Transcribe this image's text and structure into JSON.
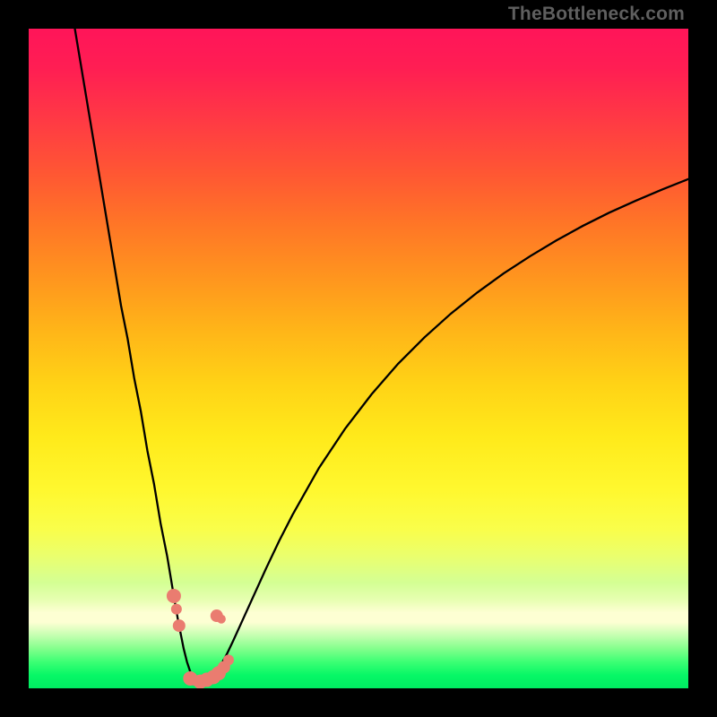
{
  "watermark": "TheBottleneck.com",
  "chart_data": {
    "type": "line",
    "title": "",
    "xlabel": "",
    "ylabel": "",
    "xlim": [
      0,
      100
    ],
    "ylim": [
      0,
      100
    ],
    "grid": false,
    "legend": false,
    "series": [
      {
        "name": "bottleneck-curve",
        "color": "#000000",
        "x": [
          7,
          8,
          9,
          10,
          11,
          12,
          13,
          14,
          15,
          16,
          17,
          18,
          19,
          20,
          21,
          22,
          22.7,
          23.5,
          24,
          24.5,
          25,
          25.5,
          26,
          27,
          28,
          29,
          30,
          31,
          32,
          34,
          36,
          38,
          40,
          44,
          48,
          52,
          56,
          60,
          64,
          68,
          72,
          76,
          80,
          84,
          88,
          92,
          96,
          100
        ],
        "y": [
          100,
          94,
          88,
          82,
          76,
          70,
          64,
          58,
          53,
          47,
          42,
          36,
          31,
          25,
          20,
          14,
          10,
          6,
          4,
          2.5,
          1.3,
          0.7,
          0.3,
          0.7,
          1.8,
          3.3,
          5.1,
          7.2,
          9.4,
          13.8,
          18.2,
          22.4,
          26.3,
          33.4,
          39.4,
          44.6,
          49.2,
          53.2,
          56.8,
          60.0,
          62.9,
          65.5,
          67.9,
          70.1,
          72.1,
          73.9,
          75.6,
          77.2
        ]
      }
    ],
    "markers": [
      {
        "x": 22.0,
        "y": 14.0,
        "r": 8
      },
      {
        "x": 22.4,
        "y": 12.0,
        "r": 6
      },
      {
        "x": 22.8,
        "y": 9.5,
        "r": 7
      },
      {
        "x": 28.5,
        "y": 11.0,
        "r": 7
      },
      {
        "x": 29.2,
        "y": 10.5,
        "r": 5
      },
      {
        "x": 24.5,
        "y": 1.5,
        "r": 8
      },
      {
        "x": 25.2,
        "y": 1.2,
        "r": 6
      },
      {
        "x": 26.0,
        "y": 1.0,
        "r": 8
      },
      {
        "x": 27.0,
        "y": 1.3,
        "r": 8
      },
      {
        "x": 28.0,
        "y": 1.7,
        "r": 8
      },
      {
        "x": 28.8,
        "y": 2.3,
        "r": 8
      },
      {
        "x": 29.6,
        "y": 3.2,
        "r": 7
      },
      {
        "x": 30.3,
        "y": 4.3,
        "r": 6
      }
    ],
    "marker_color": "#ea7c70",
    "gradient_stops": [
      {
        "pos": 0.0,
        "color": "#ff1559"
      },
      {
        "pos": 0.3,
        "color": "#ff7726"
      },
      {
        "pos": 0.6,
        "color": "#ffe91b"
      },
      {
        "pos": 0.88,
        "color": "#fdffd3"
      },
      {
        "pos": 1.0,
        "color": "#00ec62"
      }
    ]
  }
}
